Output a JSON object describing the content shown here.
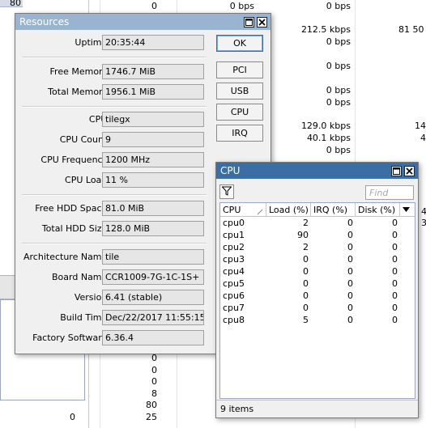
{
  "background": {
    "left_top_number": "80",
    "rows": [
      {
        "c1": "0",
        "c2": "0 bps",
        "c3": "0 bps",
        "c4": ""
      },
      {
        "c1": "",
        "c2": "",
        "c3": "212.5 kbps",
        "c4": "81 50"
      },
      {
        "c1": "",
        "c2": "",
        "c3": "0 bps",
        "c4": ""
      },
      {
        "c1": "",
        "c2": "",
        "c3": "0 bps",
        "c4": ""
      },
      {
        "c1": "",
        "c2": "",
        "c3": "0 bps",
        "c4": ""
      },
      {
        "c1": "",
        "c2": "",
        "c3": "0 bps",
        "c4": ""
      },
      {
        "c1": "",
        "c2": "",
        "c3": "129.0 kbps",
        "c4": "14"
      },
      {
        "c1": "",
        "c2": "",
        "c3": "40.1 kbps",
        "c4": "4"
      },
      {
        "c1": "",
        "c2": "",
        "c3": "0 bps",
        "c4": ""
      },
      {
        "c1": "",
        "c2": "",
        "c3": "",
        "c4": "4"
      },
      {
        "c1": "",
        "c2": "",
        "c3": "",
        "c4": "3"
      }
    ],
    "bottom_numbers": [
      "0",
      "0",
      "0",
      "8",
      "80",
      "25"
    ],
    "bottom_left_zero": "0"
  },
  "resources_window": {
    "title": "Resources",
    "fields": {
      "uptime": {
        "label": "Uptime:",
        "value": "20:35:44"
      },
      "free_memory": {
        "label": "Free Memory:",
        "value": "1746.7 MiB"
      },
      "total_memory": {
        "label": "Total Memory:",
        "value": "1956.1 MiB"
      },
      "cpu": {
        "label": "CPU:",
        "value": "tilegx"
      },
      "cpu_count": {
        "label": "CPU Count:",
        "value": "9"
      },
      "cpu_frequency": {
        "label": "CPU Frequency:",
        "value": "1200 MHz"
      },
      "cpu_load": {
        "label": "CPU Load:",
        "value": "11 %"
      },
      "free_hdd": {
        "label": "Free HDD Space:",
        "value": "81.0 MiB"
      },
      "total_hdd": {
        "label": "Total HDD Size:",
        "value": "128.0 MiB"
      },
      "architecture": {
        "label": "Architecture Name:",
        "value": "tile"
      },
      "board": {
        "label": "Board Name:",
        "value": "CCR1009-7G-1C-1S+"
      },
      "version": {
        "label": "Version:",
        "value": "6.41 (stable)"
      },
      "build_time": {
        "label": "Build Time:",
        "value": "Dec/22/2017 11:55:15"
      },
      "factory_software": {
        "label": "Factory Software:",
        "value": "6.36.4"
      }
    },
    "buttons": {
      "ok": "OK",
      "pci": "PCI",
      "usb": "USB",
      "cpu": "CPU",
      "irq": "IRQ"
    }
  },
  "cpu_window": {
    "title": "CPU",
    "find_placeholder": "Find",
    "columns": [
      "CPU",
      "Load (%)",
      "IRQ (%)",
      "Disk (%)"
    ],
    "rows": [
      {
        "cpu": "cpu0",
        "load": "2",
        "irq": "0",
        "disk": "0"
      },
      {
        "cpu": "cpu1",
        "load": "90",
        "irq": "0",
        "disk": "0"
      },
      {
        "cpu": "cpu2",
        "load": "2",
        "irq": "0",
        "disk": "0"
      },
      {
        "cpu": "cpu3",
        "load": "0",
        "irq": "0",
        "disk": "0"
      },
      {
        "cpu": "cpu4",
        "load": "0",
        "irq": "0",
        "disk": "0"
      },
      {
        "cpu": "cpu5",
        "load": "0",
        "irq": "0",
        "disk": "0"
      },
      {
        "cpu": "cpu6",
        "load": "0",
        "irq": "0",
        "disk": "0"
      },
      {
        "cpu": "cpu7",
        "load": "0",
        "irq": "0",
        "disk": "0"
      },
      {
        "cpu": "cpu8",
        "load": "5",
        "irq": "0",
        "disk": "0"
      }
    ],
    "status": "9 items"
  },
  "colors": {
    "titlebar_active": "#3a6ea5",
    "titlebar_inactive": "#99b4d1",
    "window_bg": "#f0f0f0"
  }
}
